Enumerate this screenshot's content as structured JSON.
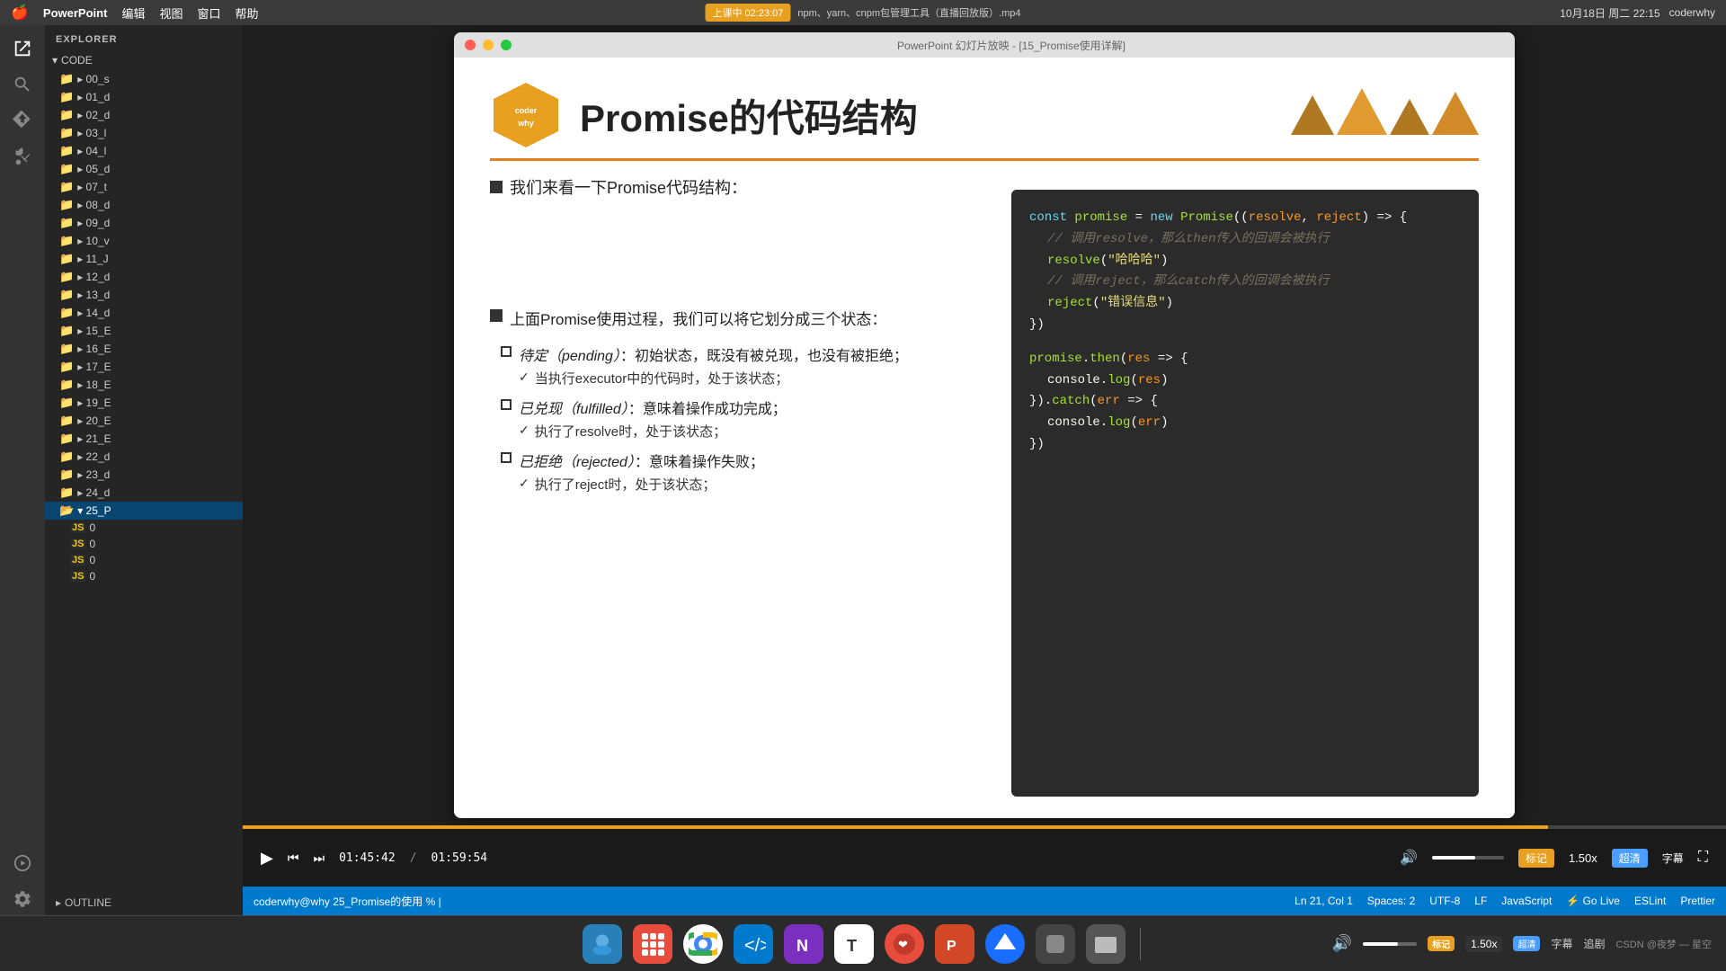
{
  "menubar": {
    "apple": "🍎",
    "app": "PowerPoint",
    "menus": [
      "编辑",
      "视图",
      "窗口",
      "帮助"
    ],
    "center_text": "上课中 02:23:07",
    "window_title": "npm、yarn、cnpm包管理工具（直播回放版）.mp4",
    "powerpoint_subtitle": "PowerPoint 幻灯片放映 - [15_Promise使用详解]",
    "right_time": "10月18日 周二  22:15",
    "right_user": "coderwhy"
  },
  "sidebar": {
    "header": "EXPLORER",
    "section": "CODE",
    "folders": [
      {
        "name": "00_s",
        "indent": 0
      },
      {
        "name": "01_d",
        "indent": 0
      },
      {
        "name": "02_d",
        "indent": 0
      },
      {
        "name": "03_l",
        "indent": 0
      },
      {
        "name": "04_l",
        "indent": 0
      },
      {
        "name": "05_d",
        "indent": 0
      },
      {
        "name": "07_t",
        "indent": 0
      },
      {
        "name": "08_d",
        "indent": 0
      },
      {
        "name": "09_d",
        "indent": 0
      },
      {
        "name": "10_v",
        "indent": 0
      },
      {
        "name": "11_J",
        "indent": 0
      },
      {
        "name": "12_d",
        "indent": 0
      },
      {
        "name": "13_d",
        "indent": 0
      },
      {
        "name": "14_d",
        "indent": 0
      },
      {
        "name": "15_E",
        "indent": 0
      },
      {
        "name": "16_E",
        "indent": 0
      },
      {
        "name": "17_E",
        "indent": 0
      },
      {
        "name": "18_E",
        "indent": 0
      },
      {
        "name": "19_E",
        "indent": 0
      },
      {
        "name": "20_E",
        "indent": 0
      },
      {
        "name": "21_E",
        "indent": 0
      },
      {
        "name": "22_d",
        "indent": 0
      },
      {
        "name": "23_d",
        "indent": 0
      },
      {
        "name": "24_d",
        "indent": 0
      },
      {
        "name": "25_P",
        "indent": 0,
        "expanded": true
      }
    ],
    "js_files": [
      {
        "name": "0",
        "indent": 1
      },
      {
        "name": "0",
        "indent": 1
      },
      {
        "name": "0",
        "indent": 1
      },
      {
        "name": "0",
        "indent": 1
      }
    ],
    "outline": "OUTLINE"
  },
  "window": {
    "title": "PowerPoint 幻灯片放映 - [15_Promise使用详解]"
  },
  "slide": {
    "logo_text": "coderwhy",
    "title": "Promise的代码结构",
    "divider_color": "#e08020",
    "intro_text": "我们来看一下Promise代码结构：",
    "states_intro": "上面Promise使用过程，我们可以将它划分成三个状态：",
    "states": [
      {
        "name": "待定（pending）",
        "desc": "：初始状态，既没有被兑现，也没有被拒绝；",
        "sub": "当执行executor中的代码时，处于该状态；"
      },
      {
        "name": "已兑现（fulfilled）",
        "desc": "：意味着操作成功完成；",
        "sub": "执行了resolve时，处于该状态；"
      },
      {
        "name": "已拒绝（rejected）",
        "desc": "：意味着操作失败；",
        "sub": "执行了reject时，处于该状态；"
      }
    ],
    "code": {
      "line1": "const promise = new Promise((resolve, reject) => {",
      "comment1": "// 调用resolve，那么then传入的回调会被执行",
      "line2": "  resolve(\"哈哈哈\")",
      "comment2": "// 调用reject，那么catch传入的回调会被执行",
      "line3": "  reject(\"错误信息\")",
      "line4": "})",
      "blank": "",
      "line5": "promise.then(res => {",
      "line6": "  console.log(res)",
      "line7": "}).catch(err => {",
      "line8": "  console.log(err)",
      "line9": "})"
    }
  },
  "terminal": {
    "text": "coderwhy@why 25_Promise的使用 % |",
    "right": {
      "ln_col": "Ln 21, Col 1",
      "spaces": "Spaces: 2",
      "encoding": "UTF-8",
      "lf": "LF",
      "language": "JavaScript",
      "golive": "⚡ Go Live",
      "eslint": "ESLint",
      "prettier": "Prettier"
    }
  },
  "video_controls": {
    "current_time": "01:45:42",
    "total_time": "01:59:54",
    "progress_percent": 88
  },
  "taskbar": {
    "right_badges": [
      "标记",
      "1.50x",
      "超清",
      "字幕",
      "追剧",
      "星空"
    ],
    "csdn_text": "CSDN @夜梦 — 星空"
  }
}
